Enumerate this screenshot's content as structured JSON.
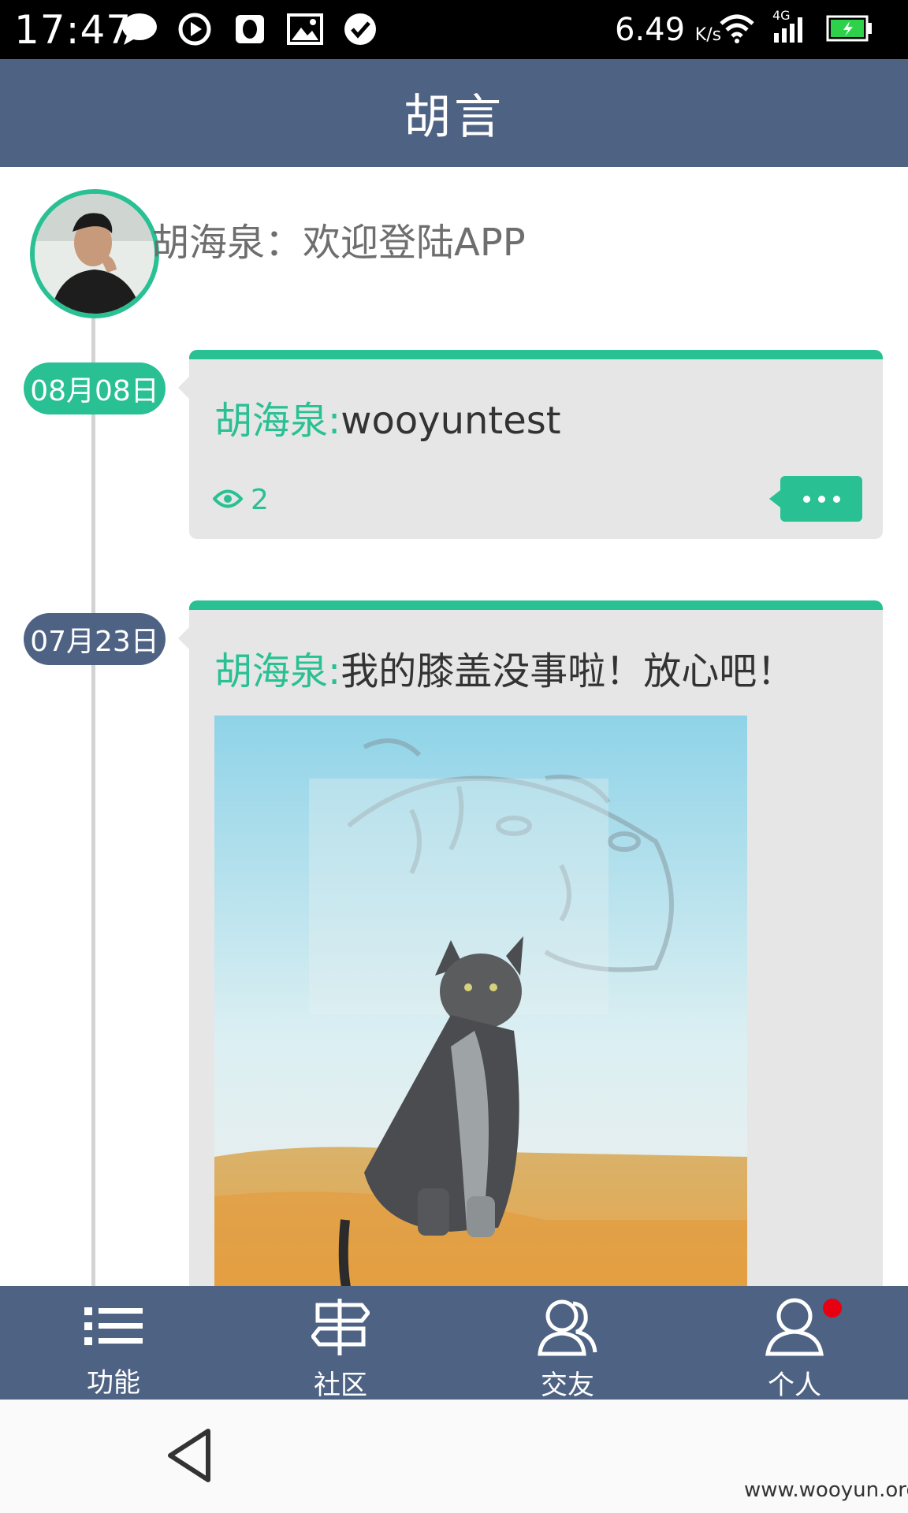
{
  "status_bar": {
    "time": "17:47",
    "speed_value": "6.49",
    "speed_unit": "K/s",
    "network": "4G",
    "left_icons": [
      "message-icon",
      "play-circle-icon",
      "qq-penguin-icon",
      "image-icon",
      "check-circle-icon"
    ],
    "right_icons": [
      "wifi-icon",
      "signal-icon",
      "battery-charging-icon"
    ]
  },
  "header": {
    "title": "胡言"
  },
  "profile": {
    "welcome_text": "胡海泉：欢迎登陆APP"
  },
  "posts": [
    {
      "date": "08月08日",
      "author": "胡海泉:",
      "text": "wooyuntest",
      "views": "2"
    },
    {
      "date": "07月23日",
      "author": "胡海泉:",
      "text": "我的膝盖没事啦！放心吧！"
    }
  ],
  "bottom_nav": {
    "items": [
      {
        "label": "功能",
        "icon": "list-icon"
      },
      {
        "label": "社区",
        "icon": "signpost-icon"
      },
      {
        "label": "交友",
        "icon": "friends-icon"
      },
      {
        "label": "个人",
        "icon": "person-icon"
      }
    ]
  },
  "watermark": "www.wooyun.org",
  "colors": {
    "accent": "#29c093",
    "bar": "#4e6283",
    "badge": "#e60012",
    "card": "#e6e6e6"
  }
}
